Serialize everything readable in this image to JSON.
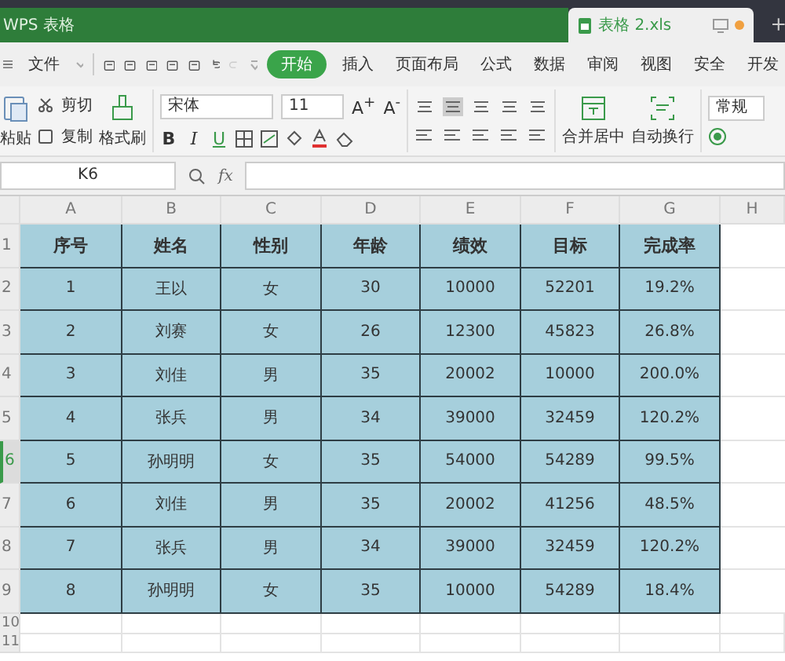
{
  "tabs": [
    {
      "label": "WPS 表格",
      "kind": "app",
      "selected": false
    },
    {
      "label": "表格 2.xls",
      "kind": "doc",
      "selected": true
    }
  ],
  "menu": {
    "file": "文件",
    "items": [
      {
        "label": "开始",
        "selected": true
      },
      {
        "label": "插入",
        "selected": false
      },
      {
        "label": "页面布局",
        "selected": false
      },
      {
        "label": "公式",
        "selected": false
      },
      {
        "label": "数据",
        "selected": false
      },
      {
        "label": "审阅",
        "selected": false
      },
      {
        "label": "视图",
        "selected": false
      },
      {
        "label": "安全",
        "selected": false
      },
      {
        "label": "开发",
        "selected": false
      }
    ]
  },
  "ribbon": {
    "paste": "粘贴",
    "cut": "剪切",
    "copy": "复制",
    "format_painter": "格式刷",
    "font": "宋体",
    "font_size": "11",
    "grow": "A$^{+}$",
    "shrink": "A$^{-}$",
    "bold": "B",
    "italic": "I",
    "underline": "U",
    "merge": "合并居中",
    "wrap": "自动换行",
    "number_format": "常规"
  },
  "name_box": "K6",
  "fx": "fx",
  "columns": [
    "A",
    "B",
    "C",
    "D",
    "E",
    "F",
    "G",
    "H"
  ],
  "rows": [
    {
      "num": "1",
      "selected": false,
      "kind": "header",
      "cells": [
        "序号",
        "姓名",
        "性别",
        "年龄",
        "绩效",
        "目标",
        "完成率"
      ]
    },
    {
      "num": "2",
      "selected": false,
      "kind": "data",
      "cells": [
        "1",
        "王以",
        "女",
        "30",
        "10000",
        "52201",
        "19.2%"
      ]
    },
    {
      "num": "3",
      "selected": false,
      "kind": "data",
      "cells": [
        "2",
        "刘赛",
        "女",
        "26",
        "12300",
        "45823",
        "26.8%"
      ]
    },
    {
      "num": "4",
      "selected": false,
      "kind": "data",
      "cells": [
        "3",
        "刘佳",
        "男",
        "35",
        "20002",
        "10000",
        "200.0%"
      ]
    },
    {
      "num": "5",
      "selected": false,
      "kind": "data",
      "cells": [
        "4",
        "张兵",
        "男",
        "34",
        "39000",
        "32459",
        "120.2%"
      ]
    },
    {
      "num": "6",
      "selected": true,
      "kind": "data",
      "cells": [
        "5",
        "孙明明",
        "女",
        "35",
        "54000",
        "54289",
        "99.5%"
      ]
    },
    {
      "num": "7",
      "selected": false,
      "kind": "data",
      "cells": [
        "6",
        "刘佳",
        "男",
        "35",
        "20002",
        "41256",
        "48.5%"
      ]
    },
    {
      "num": "8",
      "selected": false,
      "kind": "data",
      "cells": [
        "7",
        "张兵",
        "男",
        "34",
        "39000",
        "32459",
        "120.2%"
      ]
    },
    {
      "num": "9",
      "selected": false,
      "kind": "data",
      "cells": [
        "8",
        "孙明明",
        "女",
        "35",
        "10000",
        "54289",
        "18.4%"
      ]
    },
    {
      "num": "10",
      "selected": false,
      "kind": "empty",
      "cells": []
    },
    {
      "num": "11",
      "selected": false,
      "kind": "empty",
      "cells": []
    }
  ]
}
